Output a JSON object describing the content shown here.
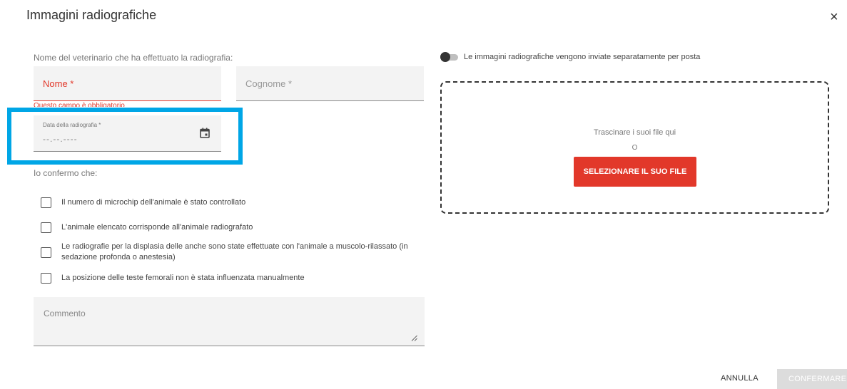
{
  "dialog": {
    "title": "Immagini radiografiche",
    "close_glyph": "×"
  },
  "vet": {
    "label": "Nome del veterinario che ha effettuato la radiografia:",
    "first_name_placeholder": "Nome *",
    "last_name_placeholder": "Cognome *",
    "error": "Questo campo è obbligatorio"
  },
  "date": {
    "label": "Data della radiografia *",
    "value": "--.--.----",
    "icon": "calendar-icon"
  },
  "confirm": {
    "label": "Io confermo che:",
    "items": [
      {
        "text": "Il numero di microchip dell'animale è stato controllato",
        "checked": false
      },
      {
        "text": "L'animale elencato corrisponde all'animale radiografato",
        "checked": false
      },
      {
        "text": "Le radiografie per la displasia delle anche sono state effettuate con l'animale a muscolo-rilassato (in sedazione profonda o anestesia)",
        "checked": false
      },
      {
        "text": "La posizione delle teste femorali non è stata influenzata manualmente",
        "checked": false
      }
    ]
  },
  "comment": {
    "placeholder": "Commento"
  },
  "mail_toggle": {
    "label": "Le immagini radiografiche vengono inviate separatamente per posta",
    "on": false
  },
  "upload": {
    "drag_text": "Trascinare i suoi file qui",
    "or_text": "O",
    "button": "SELEZIONARE IL SUO FILE"
  },
  "actions": {
    "cancel": "ANNULLA",
    "confirm": "CONFERMARE"
  },
  "colors": {
    "accent": "#e2382a",
    "highlight": "#00a6e6",
    "field_bg": "#f3f3f3",
    "disabled": "#dcdcdc"
  }
}
